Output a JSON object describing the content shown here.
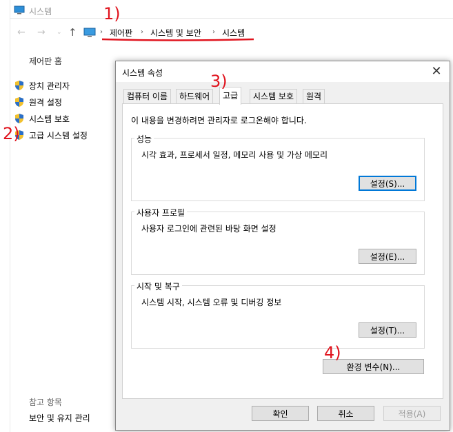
{
  "window": {
    "title": "시스템"
  },
  "nav": {
    "back": "←",
    "forward": "→",
    "down": "⌄",
    "up": "↑"
  },
  "breadcrumb": [
    "제어판",
    "시스템 및 보안",
    "시스템"
  ],
  "breadcrumb_sep": "›",
  "sidebar": {
    "home": "제어판 홈",
    "items": [
      "장치 관리자",
      "원격 설정",
      "시스템 보호",
      "고급 시스템 설정"
    ],
    "see_also_title": "참고 항목",
    "see_also_link": "보안 및 유지 관리"
  },
  "dialog": {
    "title": "시스템 속성",
    "close": "✕",
    "tabs": [
      "컴퓨터 이름",
      "하드웨어",
      "고급",
      "시스템 보호",
      "원격"
    ],
    "active_tab": "고급",
    "notice": "이 내용을 변경하려면 관리자로 로그온해야 합니다.",
    "groups": [
      {
        "title": "성능",
        "desc": "시각 효과, 프로세서 일정, 메모리 사용 및 가상 메모리",
        "button": "설정(S)..."
      },
      {
        "title": "사용자 프로필",
        "desc": "사용자 로그인에 관련된 바탕 화면 설정",
        "button": "설정(E)..."
      },
      {
        "title": "시작 및 복구",
        "desc": "시스템 시작, 시스템 오류 및 디버깅 정보",
        "button": "설정(T)..."
      }
    ],
    "env_button": "환경 변수(N)...",
    "ok": "확인",
    "cancel": "취소",
    "apply": "적용(A)"
  },
  "annotations": [
    "1)",
    "2)",
    "3)",
    "4)"
  ],
  "colors": {
    "annotation": "#e0141e",
    "accent": "#0078d7"
  }
}
